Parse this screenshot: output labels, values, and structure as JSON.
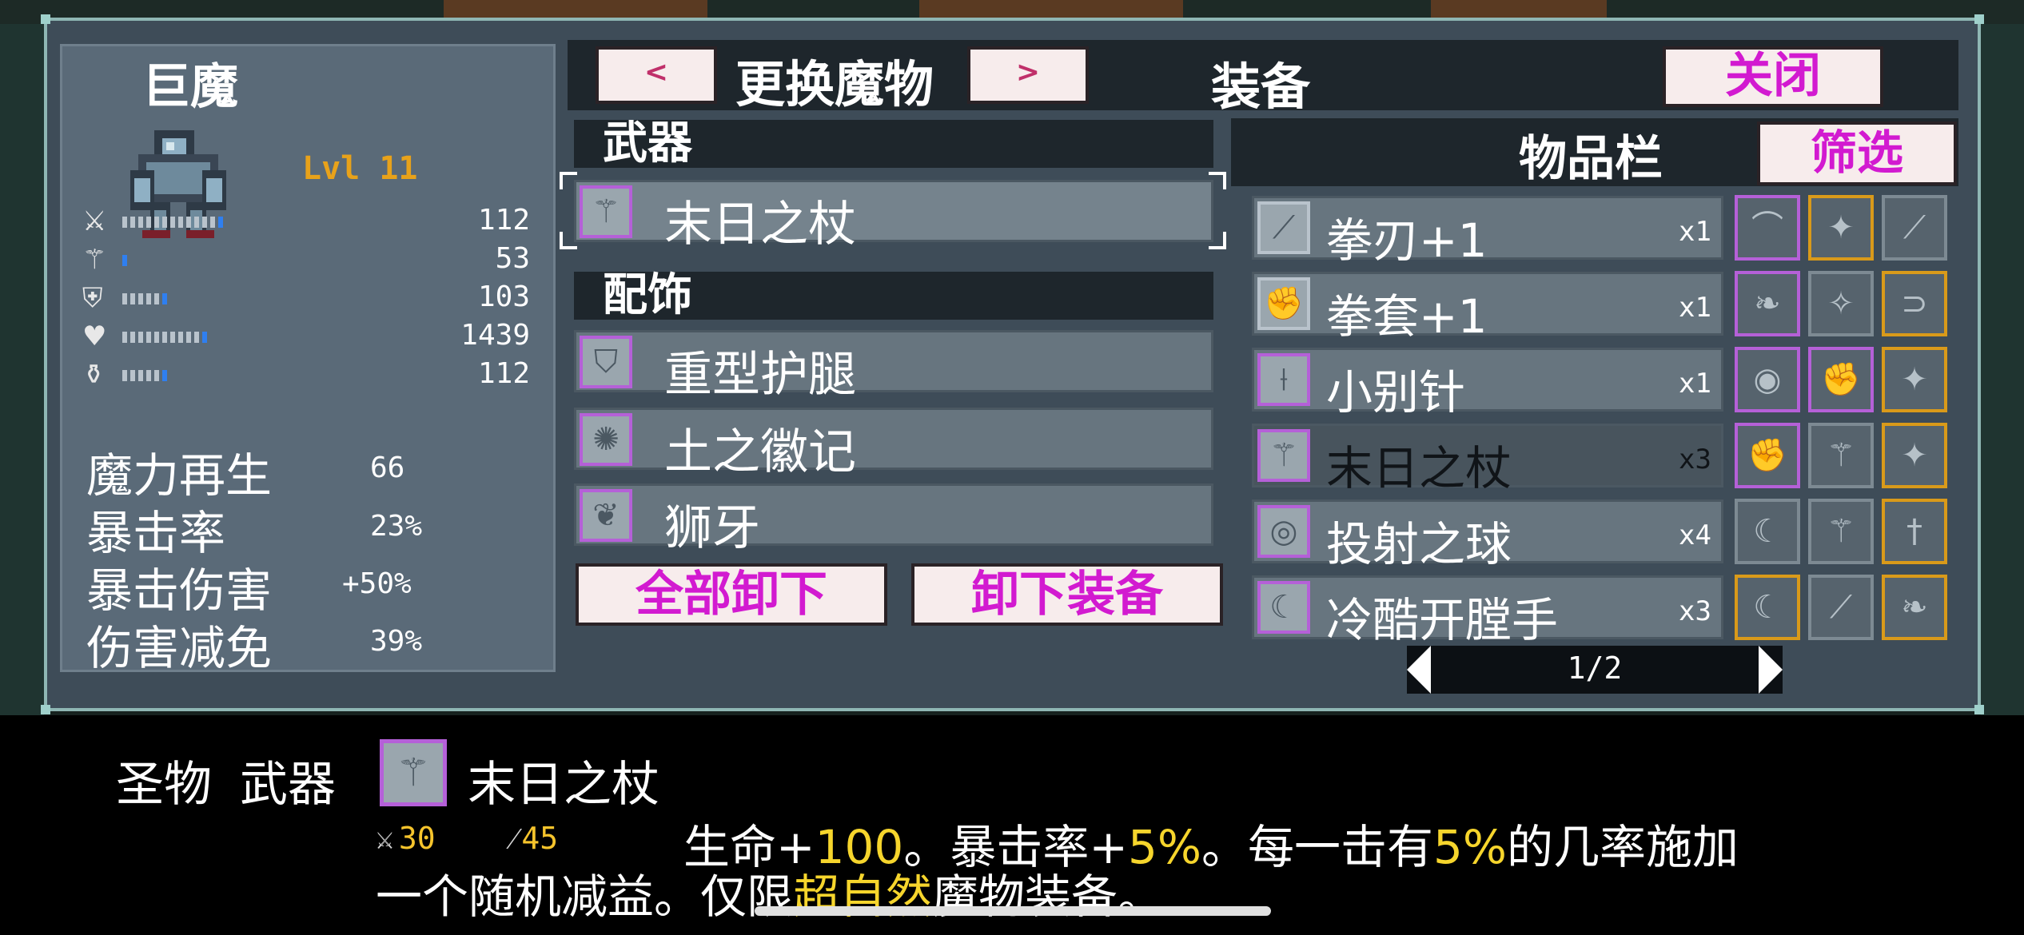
{
  "monster": {
    "name": "巨魔",
    "level": "Lvl 11",
    "stats": [
      {
        "icon": "sword-icon",
        "value": "112",
        "bar_fill": 0.9
      },
      {
        "icon": "staff-icon",
        "value": "53",
        "bar_fill": 0.1
      },
      {
        "icon": "shield-icon",
        "value": "103",
        "bar_fill": 0.45
      },
      {
        "icon": "heart-icon",
        "value": "1439",
        "bar_fill": 0.75
      },
      {
        "icon": "potion-icon",
        "value": "112",
        "bar_fill": 0.45
      }
    ],
    "big_stats": [
      {
        "label": "魔力再生",
        "value": "66"
      },
      {
        "label": "暴击率",
        "value": "23%"
      },
      {
        "label": "暴击伤害",
        "value": "+50%"
      },
      {
        "label": "伤害减免",
        "value": "39%"
      }
    ]
  },
  "topbar": {
    "prev_label": "<",
    "change_label": "更换魔物",
    "next_label": ">",
    "equip_title": "装备",
    "close_label": "关闭"
  },
  "equipment": {
    "weapon_header": "武器",
    "weapon": {
      "name": "末日之杖",
      "icon": "staff-icon"
    },
    "accessory_header": "配饰",
    "accessories": [
      {
        "name": "重型护腿",
        "icon": "greaves-icon"
      },
      {
        "name": "土之徽记",
        "icon": "emblem-icon"
      },
      {
        "name": "狮牙",
        "icon": "fang-icon"
      }
    ],
    "unequip_all_label": "全部卸下",
    "unequip_label": "卸下装备"
  },
  "inventory": {
    "title": "物品栏",
    "filter_label": "筛选",
    "items": [
      {
        "name": "拳刃+1",
        "count": "x1",
        "icon": "claw-icon",
        "dim": false
      },
      {
        "name": "拳套+1",
        "count": "x1",
        "icon": "gauntlet-icon",
        "dim": false
      },
      {
        "name": "小别针",
        "count": "x1",
        "icon": "pin-icon",
        "dim": false
      },
      {
        "name": "末日之杖",
        "count": "x3",
        "icon": "staff-icon",
        "dim": true
      },
      {
        "name": "投射之球",
        "count": "x4",
        "icon": "orb-icon",
        "dim": false
      },
      {
        "name": "冷酷开膛手",
        "count": "x3",
        "icon": "sickle-icon",
        "dim": false
      }
    ],
    "grid": [
      [
        "bow-icon",
        "mace-icon",
        "claw-icon"
      ],
      [
        "feather-icon",
        "shuriken-icon",
        "bracer-icon"
      ],
      [
        "ring-icon",
        "gauntlet-icon",
        "mace-icon"
      ],
      [
        "gauntlet-icon",
        "staff-icon",
        "mace-icon"
      ],
      [
        "sickle-icon",
        "staff-icon",
        "dagger-icon"
      ],
      [
        "sickle-icon",
        "claw-icon",
        "feather-icon"
      ]
    ],
    "grid_borders": [
      [
        "purple",
        "gold",
        "gray"
      ],
      [
        "purple",
        "gray",
        "gold"
      ],
      [
        "purple",
        "purple",
        "gold"
      ],
      [
        "purple",
        "gray",
        "gold"
      ],
      [
        "gray",
        "gray",
        "gold"
      ],
      [
        "gold",
        "gray",
        "gold"
      ]
    ],
    "page": "1/2"
  },
  "description": {
    "rarity": "圣物",
    "type": "武器",
    "name": "末日之杖",
    "stat1": "30",
    "stat2": "45",
    "line1_a": "生命+",
    "line1_b": "100",
    "line1_c": "。暴击率+",
    "line1_d": "5%",
    "line1_e": "。每一击有",
    "line1_f": "5%",
    "line1_g": "的几率施加",
    "line2_a": "一个随机减益。仅限",
    "line2_b": "超自然",
    "line2_c": "魔物装备。"
  },
  "colors": {
    "panel": "#3e4c58",
    "accent_purple": "#b560d8",
    "gold": "#e8a21a",
    "highlight": "#f6d52c"
  }
}
